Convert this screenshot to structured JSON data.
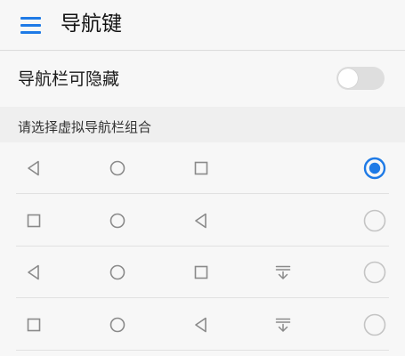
{
  "header": {
    "title": "导航键",
    "menu_icon": "hamburger-menu-icon"
  },
  "settings": {
    "hide_navbar": {
      "label": "导航栏可隐藏",
      "enabled": false
    }
  },
  "section": {
    "title": "请选择虚拟导航栏组合"
  },
  "nav_combinations": [
    {
      "keys": [
        "back",
        "home",
        "recent"
      ],
      "selected": true
    },
    {
      "keys": [
        "recent",
        "home",
        "back"
      ],
      "selected": false
    },
    {
      "keys": [
        "back",
        "home",
        "recent",
        "notification"
      ],
      "selected": false
    },
    {
      "keys": [
        "recent",
        "home",
        "back",
        "notification"
      ],
      "selected": false
    }
  ],
  "colors": {
    "accent": "#1e7ae6",
    "icon_gray": "#8a8a8a",
    "radio_border": "#c4c4c4",
    "toggle_off_track": "#dedede"
  }
}
